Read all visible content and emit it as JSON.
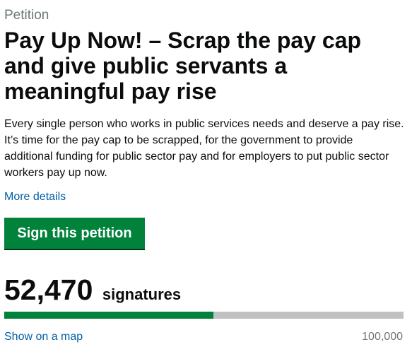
{
  "petition": {
    "kicker": "Petition",
    "title": "Pay Up Now! – Scrap the pay cap and give public servants a meaningful pay rise",
    "description": "Every single person who works in public services needs and deserve a pay rise. It’s time for the pay cap to be scrapped, for the government to provide additional funding for public sector pay and for employers to put public sector workers pay up now.",
    "more_details_label": "More details",
    "sign_button_label": "Sign this petition"
  },
  "signatures": {
    "count": "52,470",
    "label": "signatures",
    "target": "100,000",
    "progress_fraction": 0.5247,
    "show_map_label": "Show on a map"
  },
  "colors": {
    "text": "#0b0c0c",
    "secondary_text": "#6f777b",
    "link": "#005ea5",
    "button_green": "#00823b",
    "button_shadow": "#003618",
    "progress_track": "#bfc1c3"
  }
}
